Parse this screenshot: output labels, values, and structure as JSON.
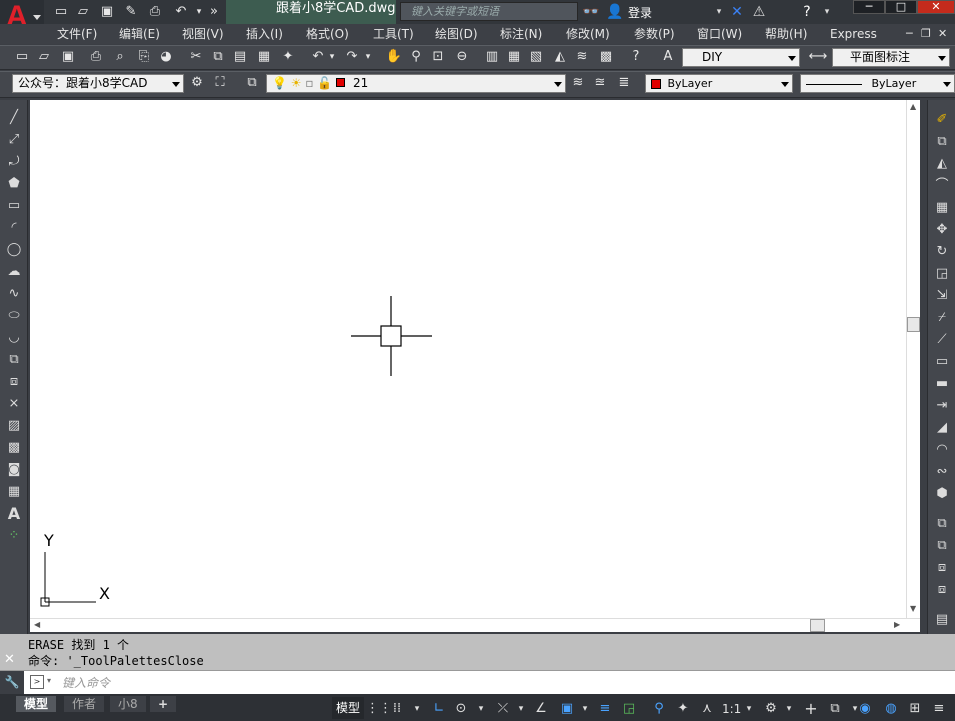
{
  "app": {
    "logo_letter": "A",
    "doc_title": "跟着小8学CAD.dwg",
    "search_placeholder": "键入关键字或短语",
    "login_label": "登录"
  },
  "menu": [
    "文件(F)",
    "编辑(E)",
    "视图(V)",
    "插入(I)",
    "格式(O)",
    "工具(T)",
    "绘图(D)",
    "标注(N)",
    "修改(M)",
    "参数(P)",
    "窗口(W)",
    "帮助(H)",
    "Express"
  ],
  "toolbar": {
    "text_style": "DIY",
    "dim_style": "平面图标注",
    "workspace": "公众号：跟着小8学CAD",
    "layer": "21",
    "color": "ByLayer",
    "linetype": "ByLayer"
  },
  "commands": {
    "history": [
      "ERASE 找到 1 个",
      "命令: '_ToolPalettesClose"
    ],
    "placeholder": "键入命令"
  },
  "ucs": {
    "x_label": "X",
    "y_label": "Y"
  },
  "status": {
    "tabs": [
      "模型",
      "作者",
      "小8"
    ],
    "add_tab": "+",
    "model_label": "模型",
    "scale": "1:1"
  },
  "colors": {
    "layer_swatch": "#e00000",
    "accent": "#3d5c50"
  }
}
